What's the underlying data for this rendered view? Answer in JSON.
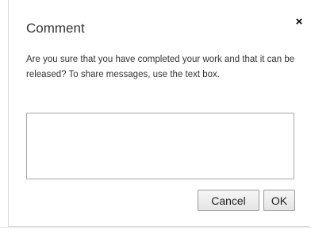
{
  "dialog": {
    "title": "Comment",
    "close_symbol": "×",
    "close_icon": "close-icon",
    "message": "Are you sure that you have completed your work and that it can be released? To share messages, use the text box.",
    "comment_value": "",
    "cancel_label": "Cancel",
    "ok_label": "OK"
  }
}
